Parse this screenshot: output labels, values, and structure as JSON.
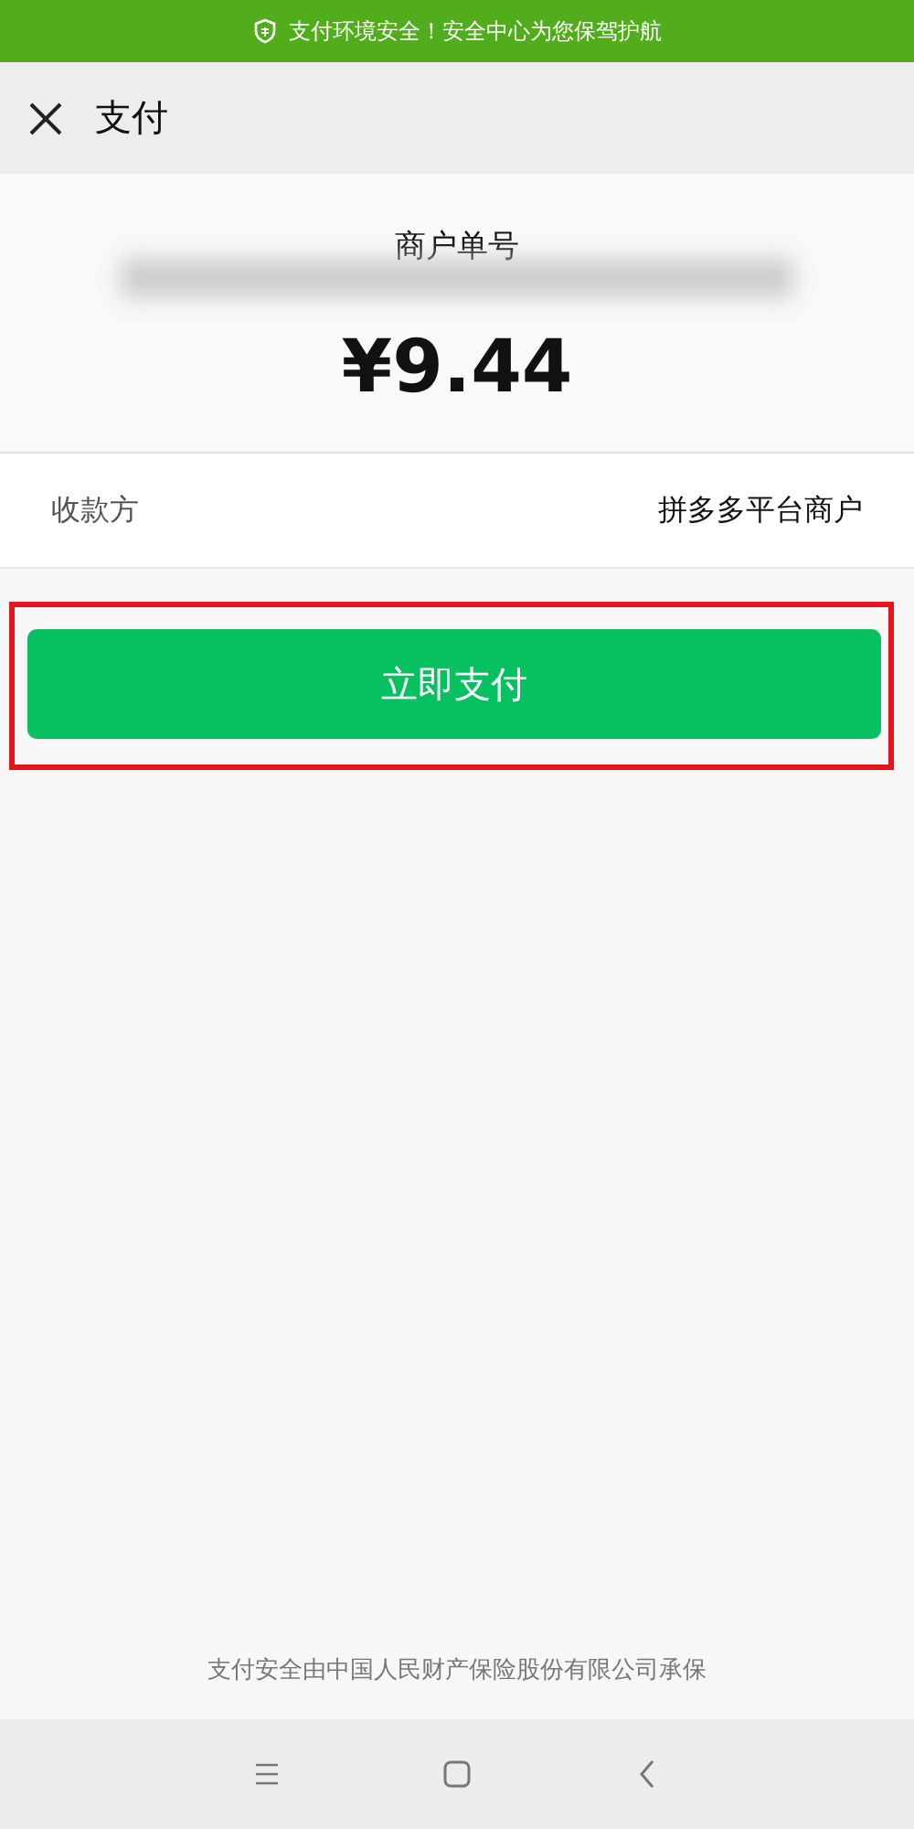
{
  "security_banner": {
    "text": "支付环境安全！安全中心为您保驾护航"
  },
  "header": {
    "title": "支付"
  },
  "order": {
    "label": "商户单号",
    "amount": "¥9.44"
  },
  "payee": {
    "label": "收款方",
    "value": "拼多多平台商户"
  },
  "pay_button": {
    "label": "立即支付",
    "highlighted": true
  },
  "footer": {
    "text": "支付安全由中国人民财产保险股份有限公司承保"
  }
}
